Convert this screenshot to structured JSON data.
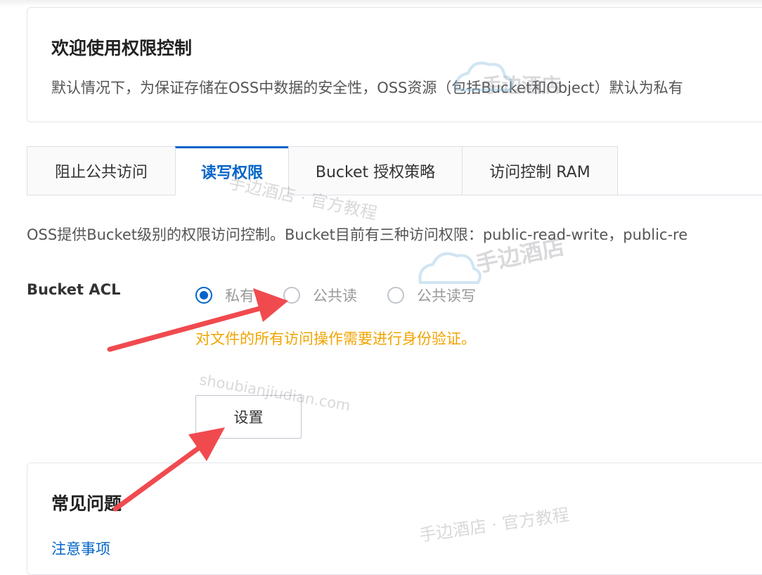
{
  "welcome": {
    "title": "欢迎使用权限控制",
    "description": "默认情况下，为保证存储在OSS中数据的安全性，OSS资源（包括Bucket和Object）默认为私有"
  },
  "tabs": [
    {
      "label": "阻止公共访问",
      "active": false
    },
    {
      "label": "读写权限",
      "active": true
    },
    {
      "label": "Bucket 授权策略",
      "active": false
    },
    {
      "label": "访问控制 RAM",
      "active": false
    }
  ],
  "acl": {
    "description": "OSS提供Bucket级别的权限访问控制。Bucket目前有三种访问权限：public-read-write，public-re",
    "label": "Bucket ACL",
    "options": [
      {
        "label": "私有",
        "checked": true
      },
      {
        "label": "公共读",
        "checked": false
      },
      {
        "label": "公共读写",
        "checked": false
      }
    ],
    "hint": "对文件的所有访问操作需要进行身份验证。",
    "set_button": "设置"
  },
  "faq": {
    "title": "常见问题",
    "link": "注意事项"
  },
  "watermarks": {
    "brand": "手边酒店",
    "brand_tutorial": "手边酒店 · 官方教程",
    "domain": "shoubianjiudian.com"
  },
  "colors": {
    "accent": "#0064c8",
    "hint": "#f0a400",
    "arrow": "#f04a4f"
  }
}
